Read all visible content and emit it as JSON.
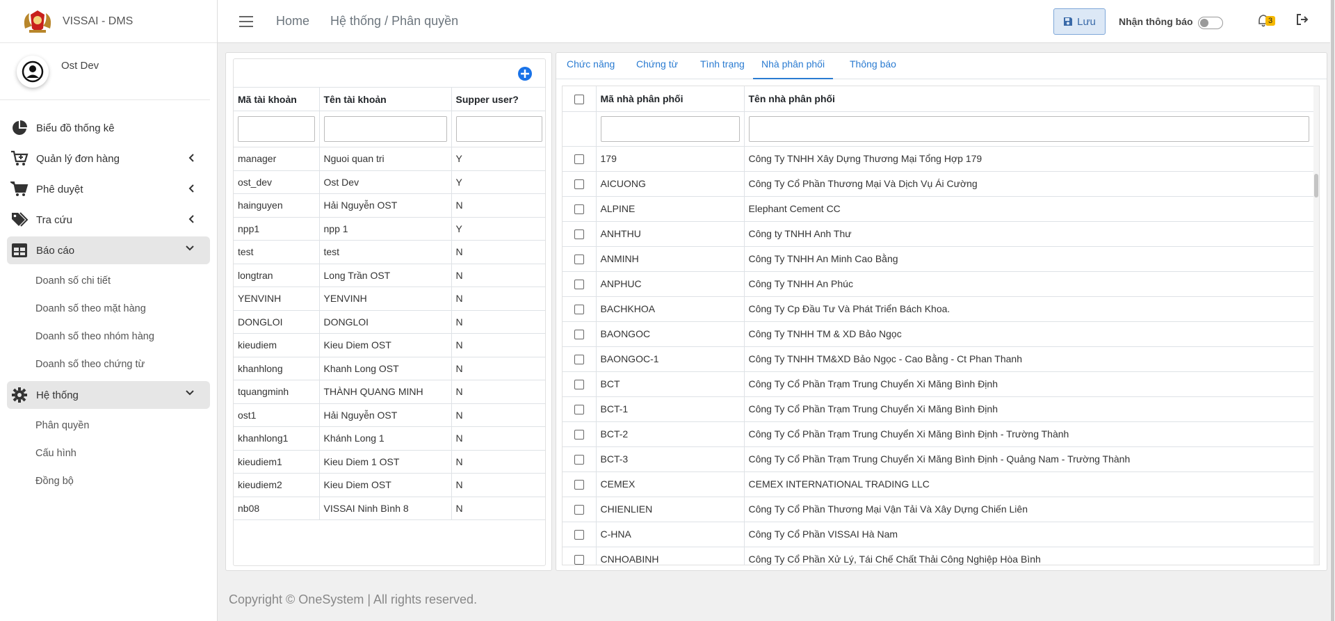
{
  "app": {
    "brand": "VISSAI - DMS"
  },
  "user": {
    "name": "Ost Dev"
  },
  "sidebar": {
    "items": [
      {
        "label": "Biểu đồ thống kê",
        "icon": "pie-chart-icon"
      },
      {
        "label": "Quản lý đơn hàng",
        "icon": "cart-plus-icon"
      },
      {
        "label": "Phê duyệt",
        "icon": "cart-icon"
      },
      {
        "label": "Tra cứu",
        "icon": "tags-icon"
      },
      {
        "label": "Báo cáo",
        "icon": "table-icon"
      },
      {
        "label": "Hệ thống",
        "icon": "gear-icon"
      }
    ],
    "report_sub": [
      "Doanh số chi tiết",
      "Doanh số theo mặt hàng",
      "Doanh số theo nhóm hàng",
      "Doanh số theo chứng từ"
    ],
    "system_sub": [
      "Phân quyền",
      "Cấu hình",
      "Đồng bộ"
    ]
  },
  "topbar": {
    "home": "Home",
    "breadcrumb": "Hệ thống / Phân quyền",
    "save_label": "Lưu",
    "notify_label": "Nhận thông báo",
    "notify_count": "3"
  },
  "accounts": {
    "headers": [
      "Mã tài khoản",
      "Tên tài khoản",
      "Supper user?"
    ],
    "rows": [
      [
        "manager",
        "Nguoi quan tri",
        "Y"
      ],
      [
        "ost_dev",
        "Ost Dev",
        "Y"
      ],
      [
        "hainguyen",
        "Hải Nguyễn OST",
        "N"
      ],
      [
        "npp1",
        "npp 1",
        "Y"
      ],
      [
        "test",
        "test",
        "N"
      ],
      [
        "longtran",
        "Long Trần OST",
        "N"
      ],
      [
        "YENVINH",
        "YENVINH",
        "N"
      ],
      [
        "DONGLOI",
        "DONGLOI",
        "N"
      ],
      [
        "kieudiem",
        "Kieu Diem OST",
        "N"
      ],
      [
        "khanhlong",
        "Khanh Long OST",
        "N"
      ],
      [
        "tquangminh",
        "THÀNH QUANG MINH",
        "N"
      ],
      [
        "ost1",
        "Hải Nguyễn OST",
        "N"
      ],
      [
        "khanhlong1",
        "Khánh Long 1",
        "N"
      ],
      [
        "kieudiem1",
        "Kieu Diem 1 OST",
        "N"
      ],
      [
        "kieudiem2",
        "Kieu Diem OST",
        "N"
      ],
      [
        "nb08",
        "VISSAI Ninh Bình 8",
        "N"
      ]
    ]
  },
  "tabs": [
    "Chức năng",
    "Chứng từ",
    "Tình trạng",
    "Nhà phân phối",
    "Thông báo"
  ],
  "active_tab": "Nhà phân phối",
  "distributors": {
    "headers": [
      "Mã nhà phân phối",
      "Tên nhà phân phối"
    ],
    "rows": [
      [
        "179",
        "Công Ty TNHH Xây Dựng Thương Mại Tổng Hợp 179"
      ],
      [
        "AICUONG",
        "Công Ty Cổ Phần Thương Mại Và Dịch Vụ Ái Cường"
      ],
      [
        "ALPINE",
        "Elephant Cement CC"
      ],
      [
        "ANHTHU",
        "Công ty TNHH Anh Thư"
      ],
      [
        "ANMINH",
        "Công Ty TNHH An Minh Cao Bằng"
      ],
      [
        "ANPHUC",
        "Công Ty TNHH An Phúc"
      ],
      [
        "BACHKHOA",
        "Công Ty Cp Đầu Tư Và Phát Triển Bách Khoa."
      ],
      [
        "BAONGOC",
        "Công Ty TNHH TM & XD Bảo Ngọc"
      ],
      [
        "BAONGOC-1",
        "Công Ty TNHH TM&XD Bảo Ngọc - Cao Bằng - Ct Phan Thanh"
      ],
      [
        "BCT",
        "Công Ty Cổ Phần Trạm Trung Chuyển Xi Măng Bình Định"
      ],
      [
        "BCT-1",
        "Công Ty Cổ Phần Trạm Trung Chuyển Xi Măng Bình Định"
      ],
      [
        "BCT-2",
        "Công Ty Cổ Phần Trạm Trung Chuyển Xi Măng Bình Định - Trường Thành"
      ],
      [
        "BCT-3",
        "Công Ty Cổ Phần Trạm Trung Chuyển Xi Măng Bình Định - Quảng Nam - Trường Thành"
      ],
      [
        "CEMEX",
        "CEMEX INTERNATIONAL TRADING LLC"
      ],
      [
        "CHIENLIEN",
        "Công Ty Cổ Phần Thương Mại Vận Tải Và Xây Dựng Chiến Liên"
      ],
      [
        "C-HNA",
        "Công Ty Cổ Phần VISSAI Hà Nam"
      ],
      [
        "CNHOABINH",
        "Công Ty Cổ Phần Xử Lý, Tái Chế Chất Thải Công Nghiệp Hòa Bình"
      ]
    ]
  },
  "footer": "Copyright © OneSystem | All rights reserved.",
  "colors": {
    "accent": "#2a7bd1",
    "link": "#2d9fd9",
    "badge": "#f5b800"
  }
}
